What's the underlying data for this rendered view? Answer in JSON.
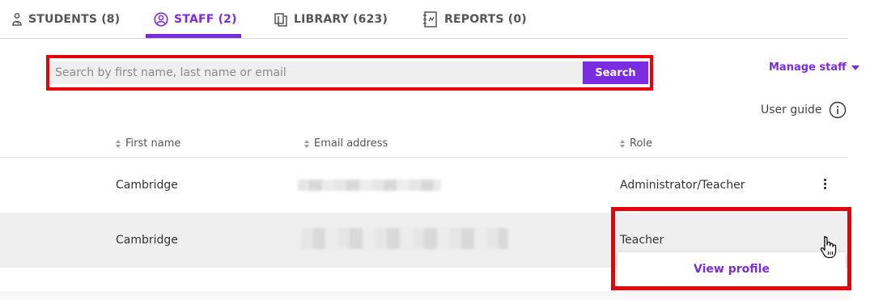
{
  "tabs": [
    {
      "label": "STUDENTS (8)",
      "icon": "student-icon",
      "active": false
    },
    {
      "label": "STAFF (2)",
      "icon": "staff-icon",
      "active": true
    },
    {
      "label": "LIBRARY (623)",
      "icon": "library-icon",
      "active": false
    },
    {
      "label": "REPORTS (0)",
      "icon": "reports-icon",
      "active": false
    }
  ],
  "search": {
    "placeholder": "Search by first name, last name or email",
    "value": "",
    "button_label": "Search"
  },
  "manage_staff": {
    "label": "Manage staff",
    "icon": "caret-down-icon"
  },
  "user_guide": {
    "label": "User guide",
    "icon": "info-icon"
  },
  "table": {
    "columns": [
      "First name",
      "Email address",
      "Role"
    ],
    "rows": [
      {
        "first_name": "Cambridge",
        "email": "",
        "role": "Administrator/Teacher"
      },
      {
        "first_name": "Cambridge",
        "email": "",
        "role": "Teacher"
      }
    ]
  },
  "row_menu": {
    "items": [
      "View profile"
    ]
  },
  "colors": {
    "accent": "#7c2ce0",
    "highlight_frame": "#e8000b",
    "row_alt_bg": "#efefef"
  }
}
